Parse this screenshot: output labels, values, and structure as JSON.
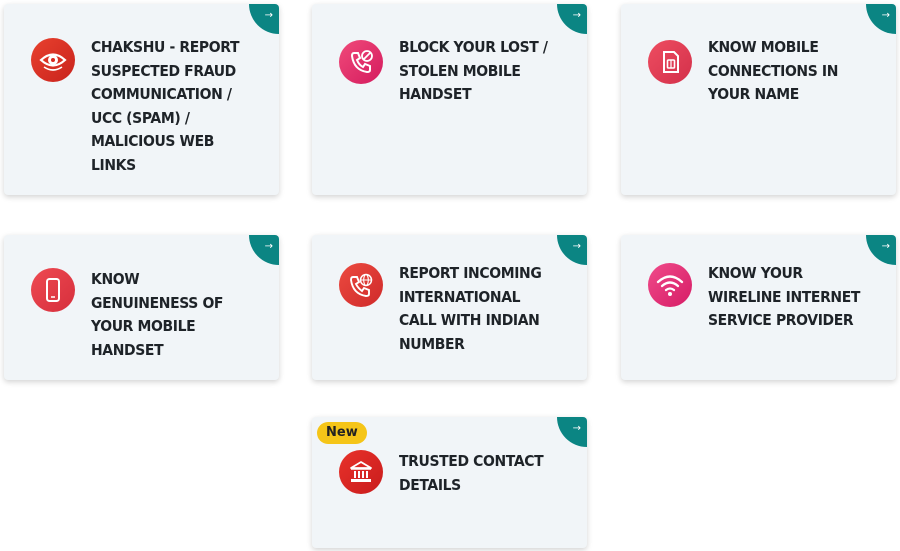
{
  "cards": [
    {
      "title": "Chakshu - Report Suspected Fraud Communication / UCC (Spam) / Malicious Web Links",
      "icon": "eye-icon",
      "arrow": "→"
    },
    {
      "title": "Block Your Lost / Stolen Mobile Handset",
      "icon": "phone-block-icon",
      "arrow": "→"
    },
    {
      "title": "Know Mobile Connections in Your Name",
      "icon": "sim-card-icon",
      "arrow": "→"
    },
    {
      "title": "Know Genuineness of Your Mobile Handset",
      "icon": "mobile-phone-icon",
      "arrow": "→"
    },
    {
      "title": "Report Incoming International Call with Indian Number",
      "icon": "phone-globe-icon",
      "arrow": "→"
    },
    {
      "title": "Know Your Wireline Internet Service Provider",
      "icon": "wifi-icon",
      "arrow": "→"
    },
    {
      "title": "Trusted Contact Details",
      "icon": "bank-building-icon",
      "arrow": "→",
      "badge": "New"
    }
  ],
  "colors": {
    "card_bg": "#f1f5f8",
    "corner_teal": "#0b8583",
    "icon_red": "#e8322b",
    "icon_pink": "#e8336f",
    "badge_yellow": "#f5c518"
  }
}
